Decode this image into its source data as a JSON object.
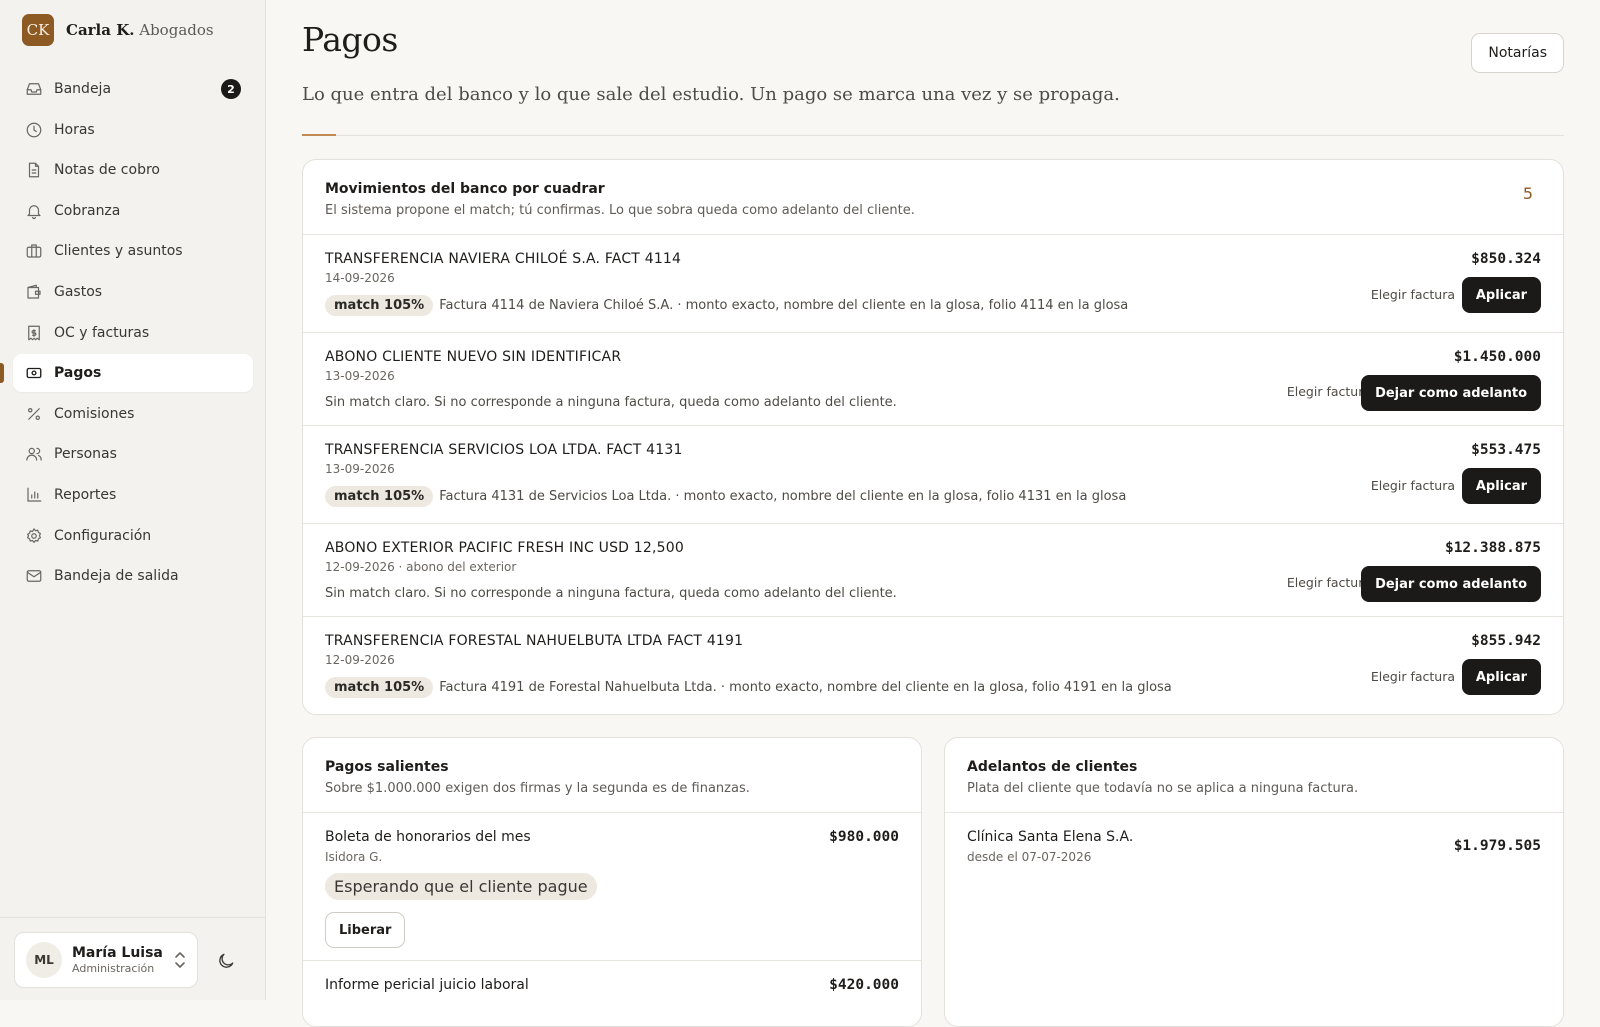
{
  "brand": {
    "logo": "CK",
    "name_bold": "Carla K.",
    "name_rest": "Abogados"
  },
  "sidebar": {
    "items": [
      {
        "label": "Bandeja",
        "icon": "inbox-icon",
        "badge": "2"
      },
      {
        "label": "Horas",
        "icon": "clock-icon"
      },
      {
        "label": "Notas de cobro",
        "icon": "document-icon"
      },
      {
        "label": "Cobranza",
        "icon": "bell-icon"
      },
      {
        "label": "Clientes y asuntos",
        "icon": "briefcase-icon"
      },
      {
        "label": "Gastos",
        "icon": "wallet-icon"
      },
      {
        "label": "OC y facturas",
        "icon": "invoice-icon"
      },
      {
        "label": "Pagos",
        "icon": "banknote-icon",
        "active": true
      },
      {
        "label": "Comisiones",
        "icon": "percent-icon"
      },
      {
        "label": "Personas",
        "icon": "users-icon"
      },
      {
        "label": "Reportes",
        "icon": "bar-chart-icon"
      },
      {
        "label": "Configuración",
        "icon": "gear-icon"
      },
      {
        "label": "Bandeja de salida",
        "icon": "mail-icon"
      }
    ]
  },
  "user": {
    "initials": "ML",
    "name": "María Luisa",
    "role": "Administración"
  },
  "page": {
    "title": "Pagos",
    "subtitle": "Lo que entra del banco y lo que sale del estudio. Un pago se marca una vez y se propaga.",
    "header_button": "Notarías"
  },
  "bank": {
    "title": "Movimientos del banco por cuadrar",
    "description": "El sistema propone el match; tú confirmas. Lo que sobra queda como adelanto del cliente.",
    "count": "5",
    "choose_label": "Elegir factura",
    "movements": [
      {
        "description": "TRANSFERENCIA NAVIERA CHILOÉ S.A. FACT 4114",
        "date": "14-09-2026",
        "amount": "$850.324",
        "match": "match 105%",
        "note": "Factura 4114 de Naviera Chiloé S.A. · monto exacto, nombre del cliente en la glosa, folio 4114 en la glosa",
        "action": "Aplicar"
      },
      {
        "description": "ABONO CLIENTE NUEVO SIN IDENTIFICAR",
        "date": "13-09-2026",
        "amount": "$1.450.000",
        "match": "",
        "note": "Sin match claro. Si no corresponde a ninguna factura, queda como adelanto del cliente.",
        "action": "Dejar como adelanto"
      },
      {
        "description": "TRANSFERENCIA SERVICIOS LOA LTDA. FACT 4131",
        "date": "13-09-2026",
        "amount": "$553.475",
        "match": "match 105%",
        "note": "Factura 4131 de Servicios Loa Ltda. · monto exacto, nombre del cliente en la glosa, folio 4131 en la glosa",
        "action": "Aplicar"
      },
      {
        "description": "ABONO EXTERIOR PACIFIC FRESH INC USD 12,500",
        "date": "12-09-2026 · abono del exterior",
        "amount": "$12.388.875",
        "match": "",
        "note": "Sin match claro. Si no corresponde a ninguna factura, queda como adelanto del cliente.",
        "action": "Dejar como adelanto"
      },
      {
        "description": "TRANSFERENCIA FORESTAL NAHUELBUTA LTDA FACT 4191",
        "date": "12-09-2026",
        "amount": "$855.942",
        "match": "match 105%",
        "note": "Factura 4191 de Forestal Nahuelbuta Ltda. · monto exacto, nombre del cliente en la glosa, folio 4191 en la glosa",
        "action": "Aplicar"
      }
    ]
  },
  "outgoing": {
    "title": "Pagos salientes",
    "description": "Sobre $1.000.000 exigen dos firmas y la segunda es de finanzas.",
    "rows": [
      {
        "title": "Boleta de honorarios del mes",
        "person": "Isidora G.",
        "amount": "$980.000",
        "status": "Esperando que el cliente pague",
        "action": "Liberar"
      },
      {
        "title": "Informe pericial juicio laboral",
        "amount": "$420.000"
      }
    ]
  },
  "advances": {
    "title": "Adelantos de clientes",
    "description": "Plata del cliente que todavía no se aplica a ninguna factura.",
    "rows": [
      {
        "client": "Clínica Santa Elena S.A.",
        "since": "desde el 07-07-2026",
        "amount": "$1.979.505"
      }
    ]
  }
}
